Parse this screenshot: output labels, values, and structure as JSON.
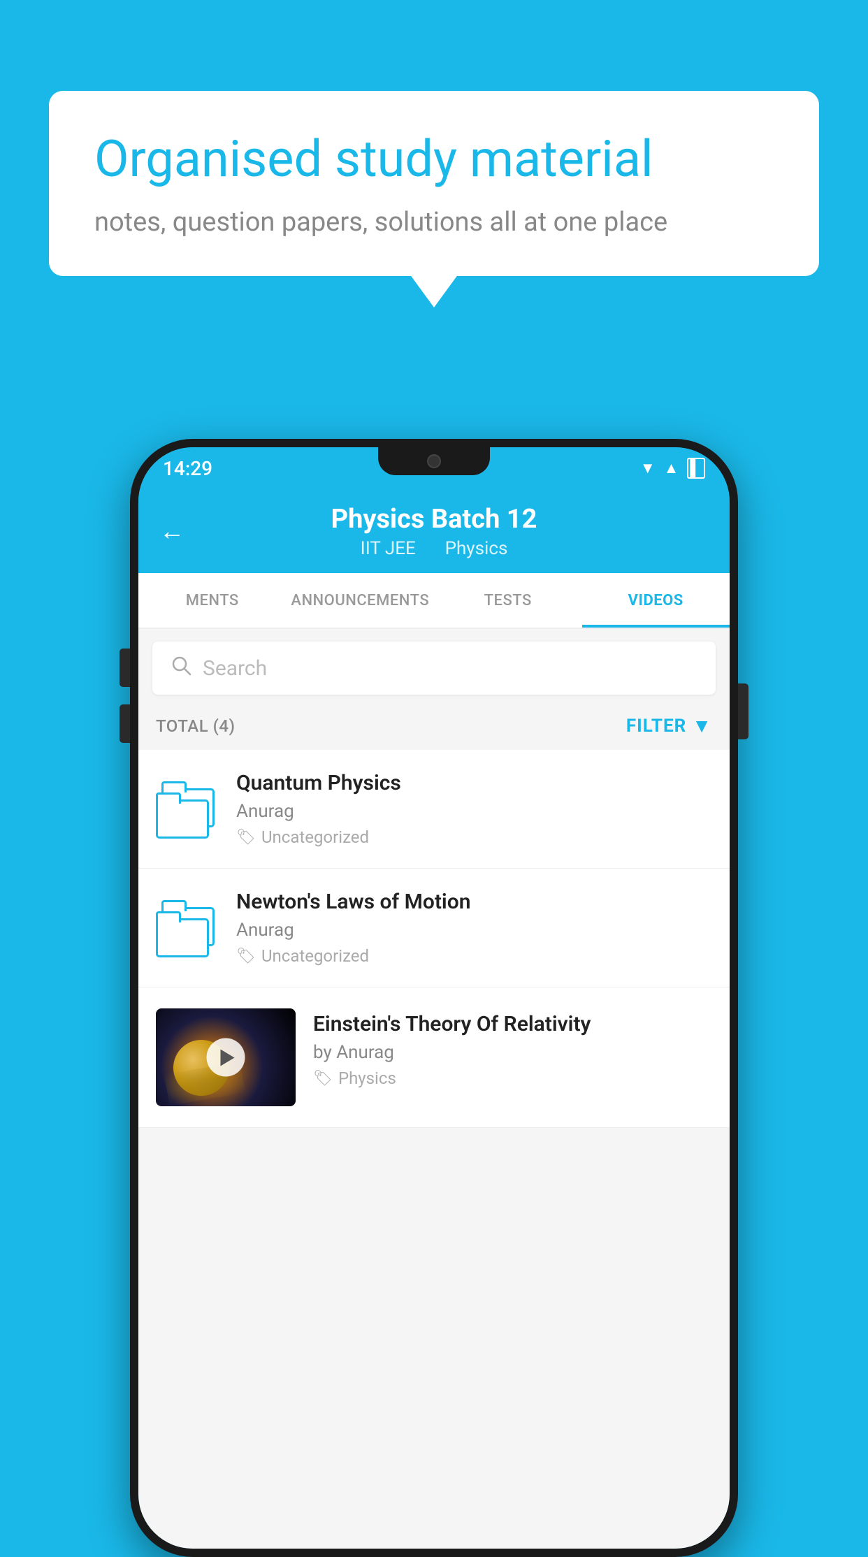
{
  "background_color": "#1ab8e8",
  "bubble": {
    "title": "Organised study material",
    "subtitle": "notes, question papers, solutions all at one place"
  },
  "status_bar": {
    "time": "14:29",
    "wifi": "▼",
    "signal": "▲",
    "battery": "▐"
  },
  "header": {
    "title": "Physics Batch 12",
    "subtitle_part1": "IIT JEE",
    "subtitle_part2": "Physics",
    "back_label": "←"
  },
  "tabs": [
    {
      "label": "MENTS",
      "active": false
    },
    {
      "label": "ANNOUNCEMENTS",
      "active": false
    },
    {
      "label": "TESTS",
      "active": false
    },
    {
      "label": "VIDEOS",
      "active": true
    }
  ],
  "search": {
    "placeholder": "Search"
  },
  "filter_bar": {
    "total_label": "TOTAL (4)",
    "filter_label": "FILTER"
  },
  "list_items": [
    {
      "title": "Quantum Physics",
      "author": "Anurag",
      "tag": "Uncategorized",
      "has_thumb": false
    },
    {
      "title": "Newton's Laws of Motion",
      "author": "Anurag",
      "tag": "Uncategorized",
      "has_thumb": false
    },
    {
      "title": "Einstein's Theory Of Relativity",
      "author": "by Anurag",
      "tag": "Physics",
      "has_thumb": true
    }
  ],
  "colors": {
    "accent": "#1ab8e8",
    "text_dark": "#222222",
    "text_muted": "#888888",
    "bg": "#f5f5f5"
  }
}
